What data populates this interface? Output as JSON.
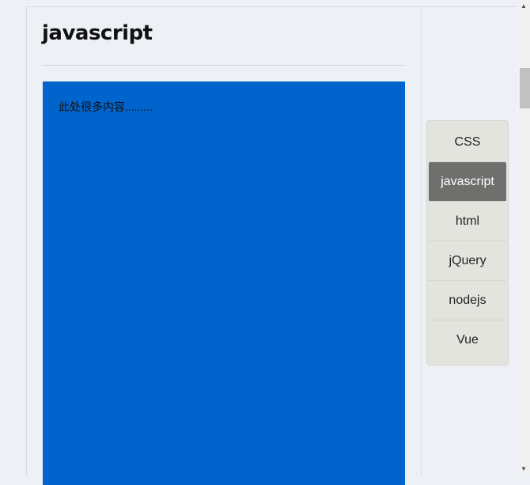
{
  "main": {
    "title": "javascript",
    "content_text": "此处很多内容.........",
    "content_bg": "#0064cd"
  },
  "nav": {
    "items": [
      {
        "label": "CSS",
        "active": false
      },
      {
        "label": "javascript",
        "active": true
      },
      {
        "label": "html",
        "active": false
      },
      {
        "label": "jQuery",
        "active": false
      },
      {
        "label": "nodejs",
        "active": false
      },
      {
        "label": "Vue",
        "active": false
      }
    ],
    "active_color": "#6f6f6d"
  },
  "scrollbar": {
    "up_icon": "triangle-up-icon",
    "down_icon": "triangle-down-icon"
  }
}
